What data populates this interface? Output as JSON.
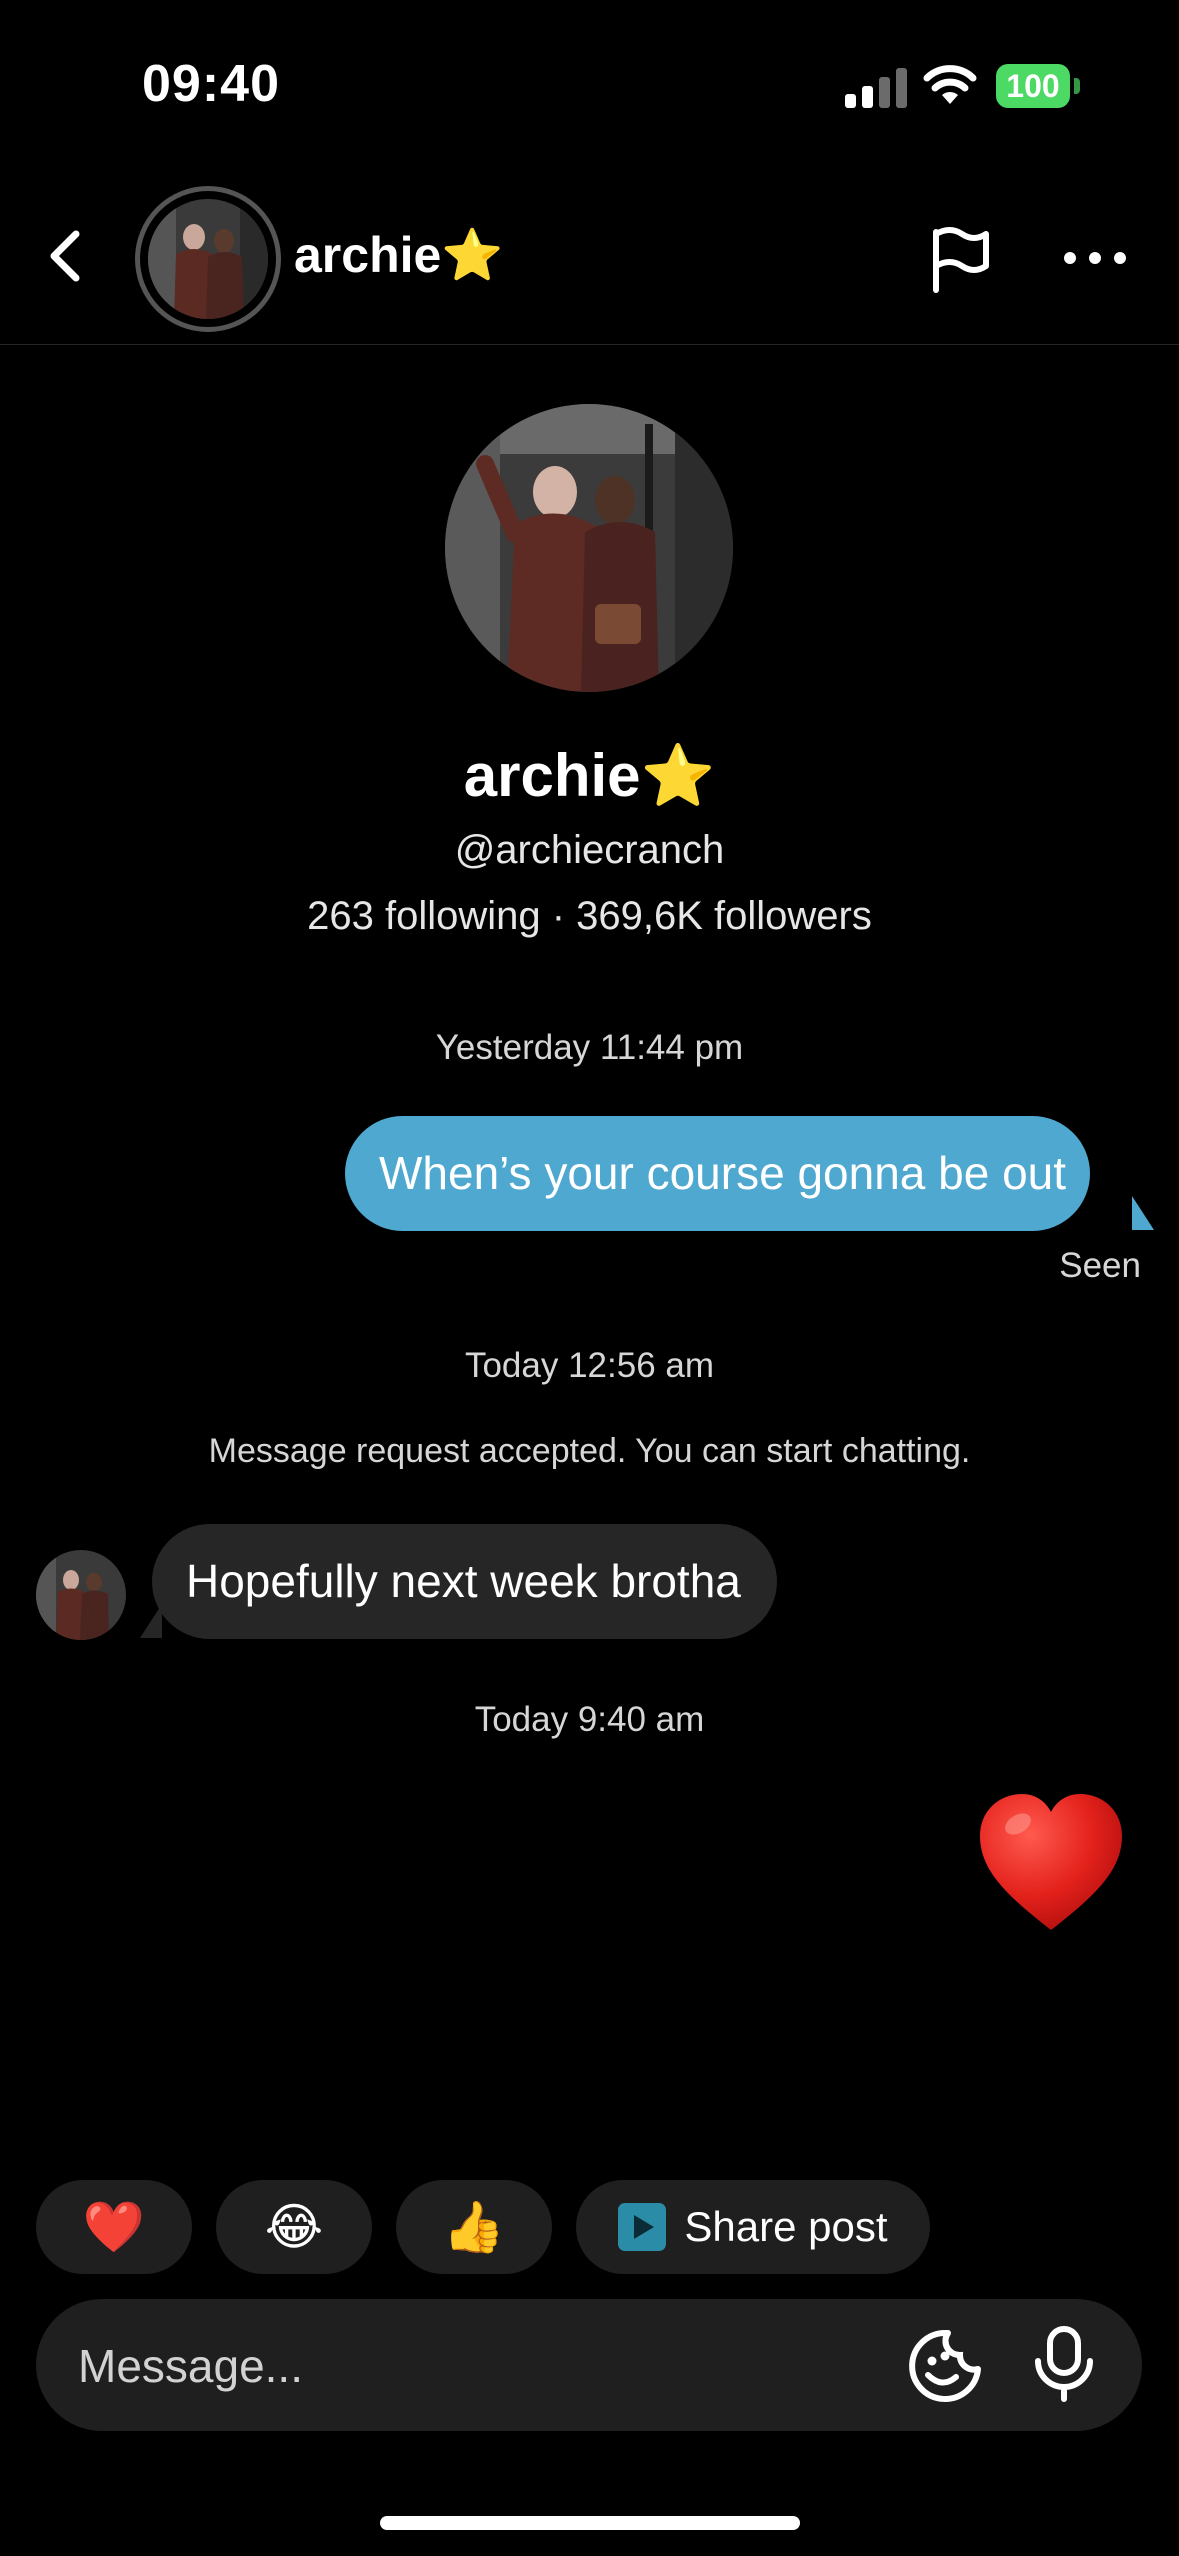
{
  "status_bar": {
    "time": "09:40",
    "battery": "100",
    "battery_color": "#4cd964"
  },
  "header": {
    "display_name": "archie⭐"
  },
  "profile": {
    "display_name": "archie⭐",
    "handle": "@archiecranch",
    "stats": "263 following · 369,6K followers"
  },
  "messages": {
    "timestamp_1": "Yesterday 11:44 pm",
    "outgoing_1": "When’s your course gonna be out",
    "seen_label": "Seen",
    "timestamp_2": "Today 12:56 am",
    "system_1": "Message request accepted. You can start chatting.",
    "incoming_1": "Hopefully next week brotha",
    "timestamp_3": "Today 9:40 am",
    "heart_reaction": "❤️"
  },
  "quick_replies": {
    "heart": "❤️",
    "laugh": "😂",
    "thumbs_up": "👍",
    "share_post": "Share post"
  },
  "composer": {
    "placeholder": "Message..."
  },
  "colors": {
    "outgoing_bubble": "#4fa8cf",
    "incoming_bubble": "#262626",
    "background": "#000000"
  },
  "icons": [
    "chevron-left-icon",
    "flag-icon",
    "more-icon",
    "sticker-icon",
    "mic-icon",
    "play-icon",
    "heart-icon"
  ]
}
